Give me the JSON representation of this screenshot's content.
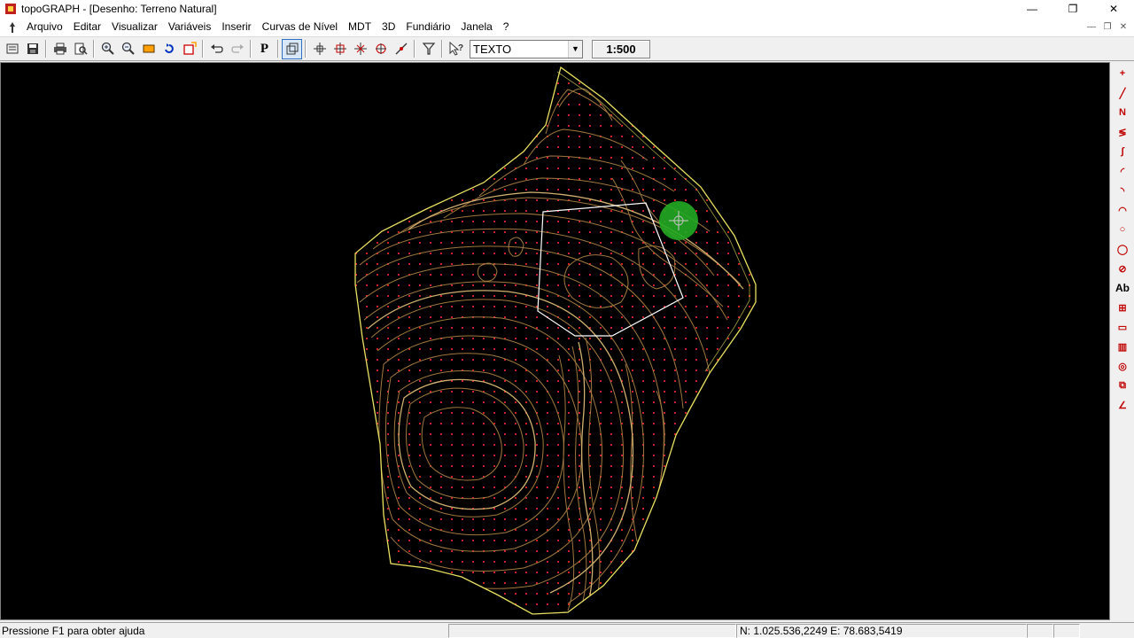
{
  "window": {
    "title": "topoGRAPH - [Desenho: Terreno Natural]",
    "minimize_icon": "minimize-icon",
    "restore_icon": "restore-icon",
    "close_icon": "close-icon"
  },
  "menu": {
    "items": [
      "Arquivo",
      "Editar",
      "Visualizar",
      "Variáveis",
      "Inserir",
      "Curvas de Nível",
      "MDT",
      "3D",
      "Fundiário",
      "Janela",
      "?"
    ]
  },
  "toolbar": {
    "text_style_value": "TEXTO",
    "scale_label": "1:500",
    "icons": [
      "list-icon",
      "save-icon",
      "print-icon",
      "print-preview-icon",
      "zoom-in-icon",
      "zoom-out-icon",
      "zoom-window-icon",
      "zoom-refresh-icon",
      "zoom-extents-icon",
      "undo-icon",
      "redo-icon",
      "properties-p-icon",
      "select-icon",
      "snap-endpoint-icon",
      "snap-midpoint-icon",
      "snap-intersection-icon",
      "snap-center-icon",
      "snap-nearest-icon",
      "filter-icon",
      "help-pointer-icon"
    ]
  },
  "right_toolbar": {
    "tools": [
      {
        "name": "point-icon",
        "glyph": "+"
      },
      {
        "name": "line-icon",
        "glyph": "╱"
      },
      {
        "name": "polyline-icon",
        "glyph": "N"
      },
      {
        "name": "multiline-icon",
        "glyph": "≶"
      },
      {
        "name": "curve-icon",
        "glyph": "∫"
      },
      {
        "name": "arc-icon",
        "glyph": "◜"
      },
      {
        "name": "arc-3pt-icon",
        "glyph": "◝"
      },
      {
        "name": "arc-center-icon",
        "glyph": "◠"
      },
      {
        "name": "circle-icon",
        "glyph": "○"
      },
      {
        "name": "circle-2pt-icon",
        "glyph": "◯"
      },
      {
        "name": "circle-radius-icon",
        "glyph": "⊘"
      },
      {
        "name": "text-icon",
        "glyph": "Ab"
      },
      {
        "name": "block-icon",
        "glyph": "⊞"
      },
      {
        "name": "rectangle-icon",
        "glyph": "▭"
      },
      {
        "name": "hatch-icon",
        "glyph": "▥"
      },
      {
        "name": "spiral-icon",
        "glyph": "◎"
      },
      {
        "name": "insert-image-icon",
        "glyph": "⧉"
      },
      {
        "name": "angle-icon",
        "glyph": "∠"
      }
    ],
    "text_tool_label": "Ab"
  },
  "status": {
    "help_text": "Pressione F1 para obter ajuda",
    "coordinates": "N: 1.025.536,2249 E: 78.683,5419"
  },
  "colors": {
    "canvas_background": "#000000",
    "boundary": "#e8e060",
    "contour": "#a07840",
    "contour_index": "#d0b070",
    "grid_points": "#d02020",
    "selection": "#ffffff",
    "cursor_highlight": "#22aa22"
  }
}
